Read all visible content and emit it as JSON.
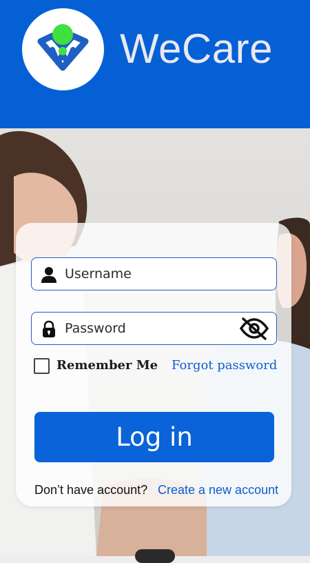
{
  "app": {
    "brand_name": "WeCare",
    "logo_icon": "wecare-logo-icon"
  },
  "colors": {
    "header": "#0560d6",
    "accent": "#0a63d8",
    "field_border": "#1b5fc7",
    "logo_green": "#3fe040",
    "logo_blue": "#1f5fc4"
  },
  "form": {
    "username": {
      "placeholder": "Username",
      "value": "",
      "icon": "user-icon"
    },
    "password": {
      "placeholder": "Password",
      "value": "",
      "icon": "lock-icon",
      "toggle_icon": "eye-off-icon"
    },
    "remember_label": "Remember Me",
    "remember_checked": false,
    "forgot_label": "Forgot password",
    "login_label": "Log in",
    "no_account_text": "Don’t have account?",
    "create_account_label": "Create a new account"
  }
}
